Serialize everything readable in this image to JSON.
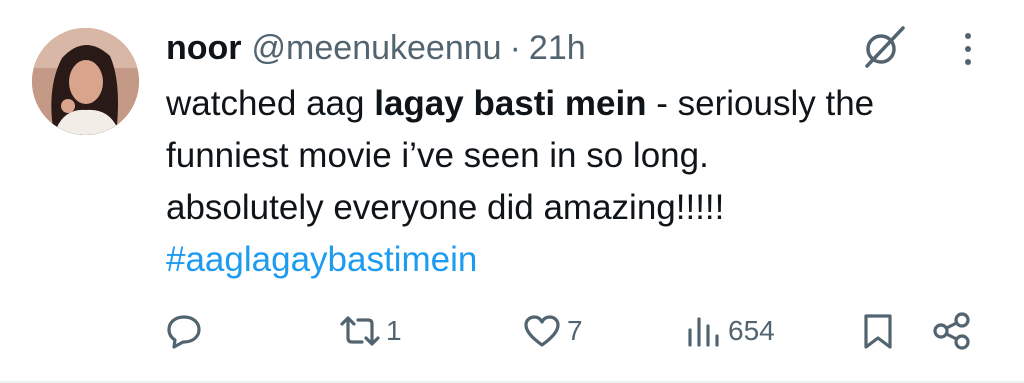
{
  "tweet": {
    "author_name": "noor",
    "handle": "@meenukeennu",
    "separator": "·",
    "time": "21h",
    "body": {
      "line1_pre": "watched aag ",
      "line1_bold": "lagay basti mein",
      "line1_post": " - seriously the",
      "line2": "funniest movie i’ve seen in so long.",
      "line3": "absolutely everyone did amazing!!!!!",
      "hashtag": "#aaglagaybastimein"
    },
    "actions": {
      "reply_icon": "reply-icon",
      "retweet_icon": "retweet-icon",
      "retweet_count": "1",
      "like_icon": "heart-icon",
      "like_count": "7",
      "views_icon": "views-icon",
      "views_count": "654",
      "bookmark_icon": "bookmark-icon",
      "share_icon": "share-icon"
    },
    "colors": {
      "text": "#0f1419",
      "secondary": "#536471",
      "link": "#1d9bf0"
    }
  }
}
